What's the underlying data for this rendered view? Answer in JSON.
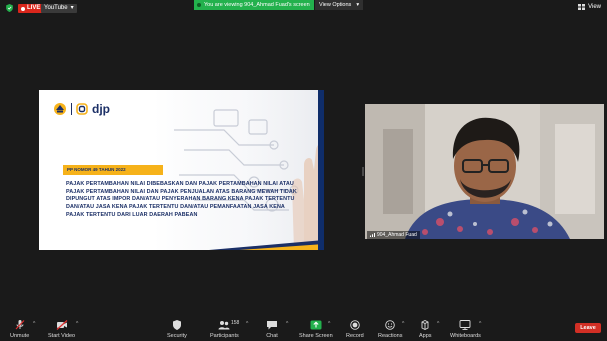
{
  "topbar": {
    "live_label": "LIVE",
    "youtube_label": "YouTube",
    "banner_text": "You are viewing 904_Ahmad Fuad's screen",
    "view_options_label": "View Options",
    "view_label": "View"
  },
  "slide": {
    "brand_text": "djp",
    "tag": "PP NOMOR 49 TAHUN 2022",
    "body": "PAJAK PERTAMBAHAN NILAI DIBEBASKAN DAN PAJAK PERTAMBAHAN NILAI ATAU PAJAK PERTAMBAHAN NILAI DAN PAJAK PENJUALAN ATAS BARANG MEWAH TIDAK DIPUNGUT ATAS IMPOR DAN/ATAU PENYERAHAN BARANG KENA PAJAK TERTENTU DAN/ATAU JASA KENA PAJAK TERTENTU DAN/ATAU PEMANFAATAN JASA KENA PAJAK TERTENTU DARI LUAR DAERAH PABEAN",
    "colors": {
      "navy": "#1b2f66",
      "gold": "#f6b21a"
    }
  },
  "camera": {
    "name": "904_Ahmad Fuad"
  },
  "toolbar": {
    "unmute": "Unmute",
    "start_video": "Start Video",
    "security": "Security",
    "participants": "Participants",
    "participant_count": "158",
    "chat": "Chat",
    "share_screen": "Share Screen",
    "record": "Record",
    "reactions": "Reactions",
    "apps": "Apps",
    "whiteboards": "Whiteboards",
    "leave": "Leave",
    "colors": {
      "share_green": "#23b14d",
      "leave_red": "#d22f25"
    }
  }
}
